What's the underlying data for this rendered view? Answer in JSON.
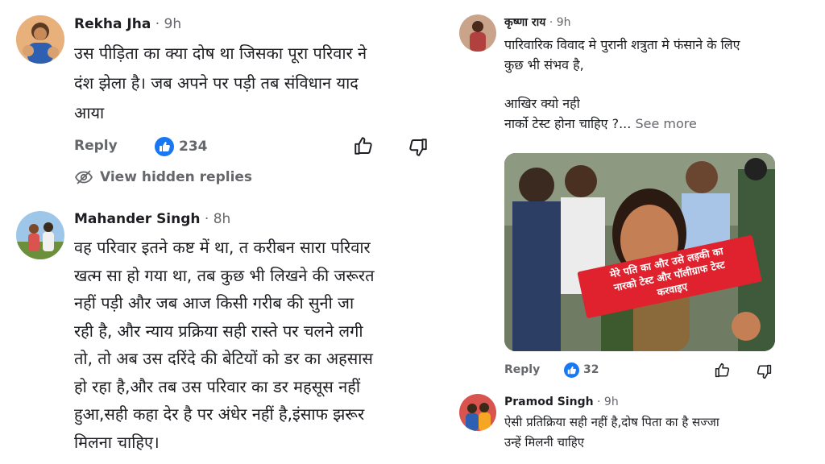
{
  "comments": [
    {
      "author": "Rekha Jha",
      "time": "· 9h",
      "text_lines": [
        "उस पीड़िता का क्या दोष था जिसका पूरा परिवार ने",
        "दंश झेला है। जब अपने पर पड़ी तब संविधान याद",
        "आया"
      ],
      "reply_label": "Reply",
      "like_count": "234",
      "hidden_replies_label": "View hidden replies"
    },
    {
      "author": "Mahander Singh",
      "time": "· 8h",
      "text_lines": [
        "वह परिवार इतने कष्ट में था, त करीबन सारा परिवार",
        "खत्म सा हो गया था, तब कुछ भी लिखने की जरूरत",
        "नहीं पड़ी और जब आज किसी गरीब की सुनी जा",
        "रही है, और न्याय प्रक्रिया सही रास्ते पर चलने लगी",
        "तो, तो अब उस दरिंदे की बेटियों को डर का अहसास",
        "हो रहा है,और तब उस परिवार का डर महसूस नहीं",
        "हुआ,सही कहा देर है पर अंधेर नहीं है,इंसाफ झरूर",
        "मिलना चाहिए।"
      ]
    },
    {
      "author": "कृष्णा राय",
      "time": "· 9h",
      "text_lines": [
        "पारिवारिक विवाद मे पुरानी शत्रुता मे फंसाने के लिए",
        " कुछ भी संभव है,",
        "",
        "आखिर क्यो नही",
        "नार्को टेस्ट  होना चाहिए ?..."
      ],
      "see_more_label": "See more",
      "photo_caption_lines": [
        "मेरे पति का और उसे लड़की का",
        "नारको टेस्ट और पॉलीग्राफ टेस्ट",
        "करवाइए"
      ],
      "reply_label": "Reply",
      "like_count": "32"
    },
    {
      "author": "Pramod Singh",
      "time": "· 9h",
      "text_lines": [
        "ऐसी प्रतिक्रिया सही नहीं है,दोष पिता का है सज्जा",
        "उन्हें मिलनी चाहिए"
      ]
    }
  ],
  "icons": {
    "like": "thumbs-up-icon",
    "dislike": "thumbs-down-icon",
    "hidden": "eye-slash-icon"
  },
  "colors": {
    "accent": "#1877f2",
    "muted": "#65676b",
    "banner": "#e0222e"
  }
}
